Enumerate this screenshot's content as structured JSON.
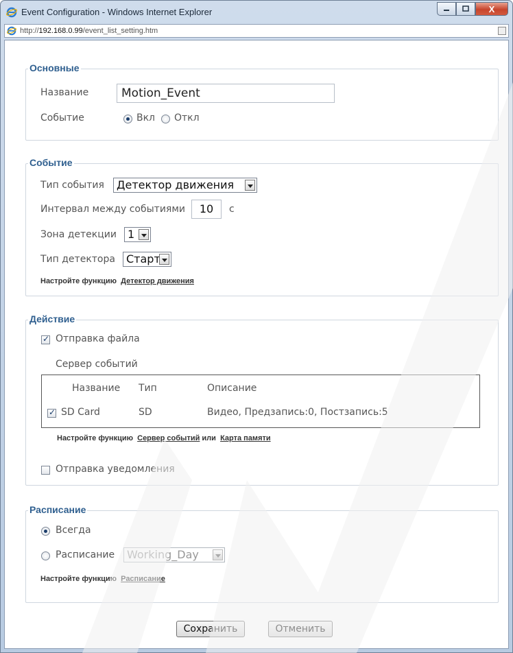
{
  "window": {
    "title": "Event Configuration - Windows Internet Explorer",
    "url_prefix": "http://",
    "url_host": "192.168.0.99",
    "url_path": "/event_list_setting.htm",
    "close_glyph": "X"
  },
  "basic": {
    "legend": "Основные",
    "name_label": "Название",
    "name_value": "Motion_Event",
    "event_label": "Событие",
    "on_label": "Вкл",
    "off_label": "Откл",
    "event_state": "on"
  },
  "event": {
    "legend": "Событие",
    "type_label": "Тип события",
    "type_value": "Детектор движения",
    "interval_label": "Интервал между событиями",
    "interval_value": "10",
    "interval_unit": "с",
    "zone_label": "Зона детекции",
    "zone_value": "1",
    "detector_label": "Тип детектора",
    "detector_value": "Старт",
    "note_prefix": "Настройте функцию",
    "note_link": "Детектор движения"
  },
  "action": {
    "legend": "Действие",
    "send_file_label": "Отправка файла",
    "send_file_checked": true,
    "server_heading": "Сервер событий",
    "table": {
      "headers": [
        "Название",
        "Тип",
        "Описание"
      ],
      "rows": [
        {
          "checked": true,
          "name": "SD Card",
          "type": "SD",
          "description": "Видео, Предзапись:0, Постзапись:5"
        }
      ]
    },
    "note_prefix": "Настройте функцию",
    "note_link1": "Сервер событий",
    "note_or": "или",
    "note_link2": "Карта памяти",
    "send_notify_label": "Отправка уведомления",
    "send_notify_checked": false
  },
  "schedule": {
    "legend": "Расписание",
    "always_label": "Всегда",
    "schedule_label": "Расписание",
    "schedule_value": "Working_Day",
    "selected": "always",
    "note_prefix": "Настройте функцию",
    "note_link": "Расписание"
  },
  "buttons": {
    "save": "Сохранить",
    "cancel": "Отменить"
  },
  "colors": {
    "legend": "#2f5f8f",
    "radio_dot": "#1b3d6b"
  }
}
